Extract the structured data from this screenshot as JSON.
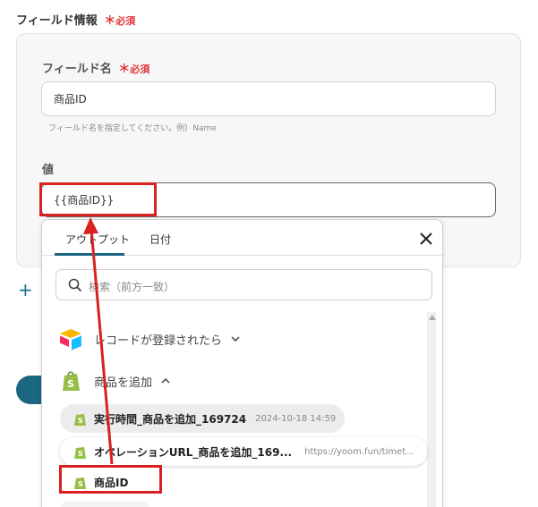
{
  "section": {
    "title": "フィールド情報",
    "required_mark": "＊",
    "required_text": "必須"
  },
  "field_name": {
    "label": "フィールド名",
    "required_mark": "＊",
    "required_text": "必須",
    "value": "商品ID",
    "hint": "フィールド名を指定してください。例）Name"
  },
  "value_field": {
    "label": "値",
    "value": "{{商品ID}}"
  },
  "popup": {
    "tabs": [
      {
        "label": "アウトプット"
      },
      {
        "label": "日付"
      }
    ],
    "search_placeholder": "検索（前方一致）",
    "groups": [
      {
        "label": "レコードが登録されたら",
        "icon": "airtable-icon"
      },
      {
        "label": "商品を追加",
        "icon": "shopify-icon"
      }
    ],
    "items": [
      {
        "name": "実行時間_商品を追加_169724",
        "meta": "2024-10-18 14:59"
      },
      {
        "name": "オペレーションURL_商品を追加_169...",
        "meta": "https://yoom.fun/timet..."
      },
      {
        "name": "商品ID",
        "meta": ""
      }
    ]
  },
  "colors": {
    "accent": "#1b6680",
    "required": "#e2343c",
    "annotation": "#d9211f"
  }
}
